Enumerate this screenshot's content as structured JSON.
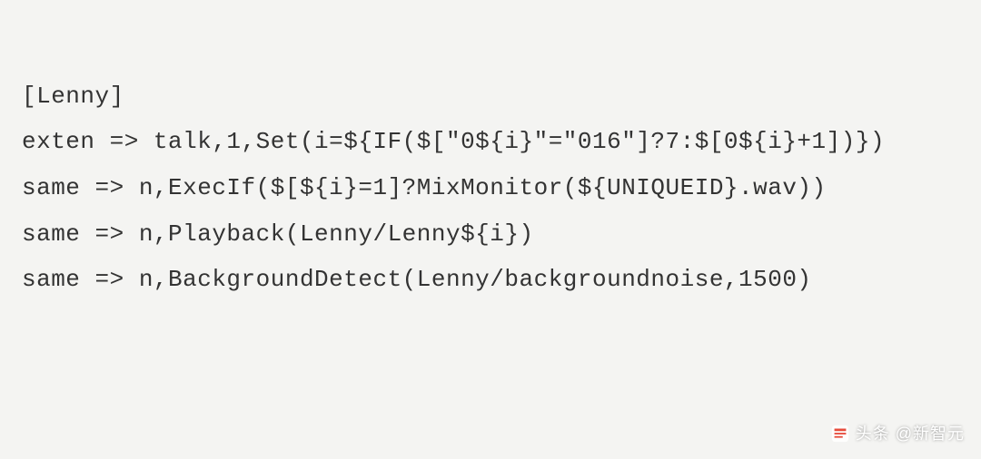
{
  "code": {
    "line1": "[Lenny]",
    "line2": "exten => talk,1,Set(i=${IF($[\"0${i}\"=\"016\"]?7:$[0${i}+1])})",
    "line3": "same => n,ExecIf($[${i}=1]?MixMonitor(${UNIQUEID}.wav))",
    "line4": "same => n,Playback(Lenny/Lenny${i})",
    "line5": "same => n,BackgroundDetect(Lenny/backgroundnoise,1500)"
  },
  "watermark": {
    "prefix": "头条",
    "attribution": "@新智元"
  }
}
